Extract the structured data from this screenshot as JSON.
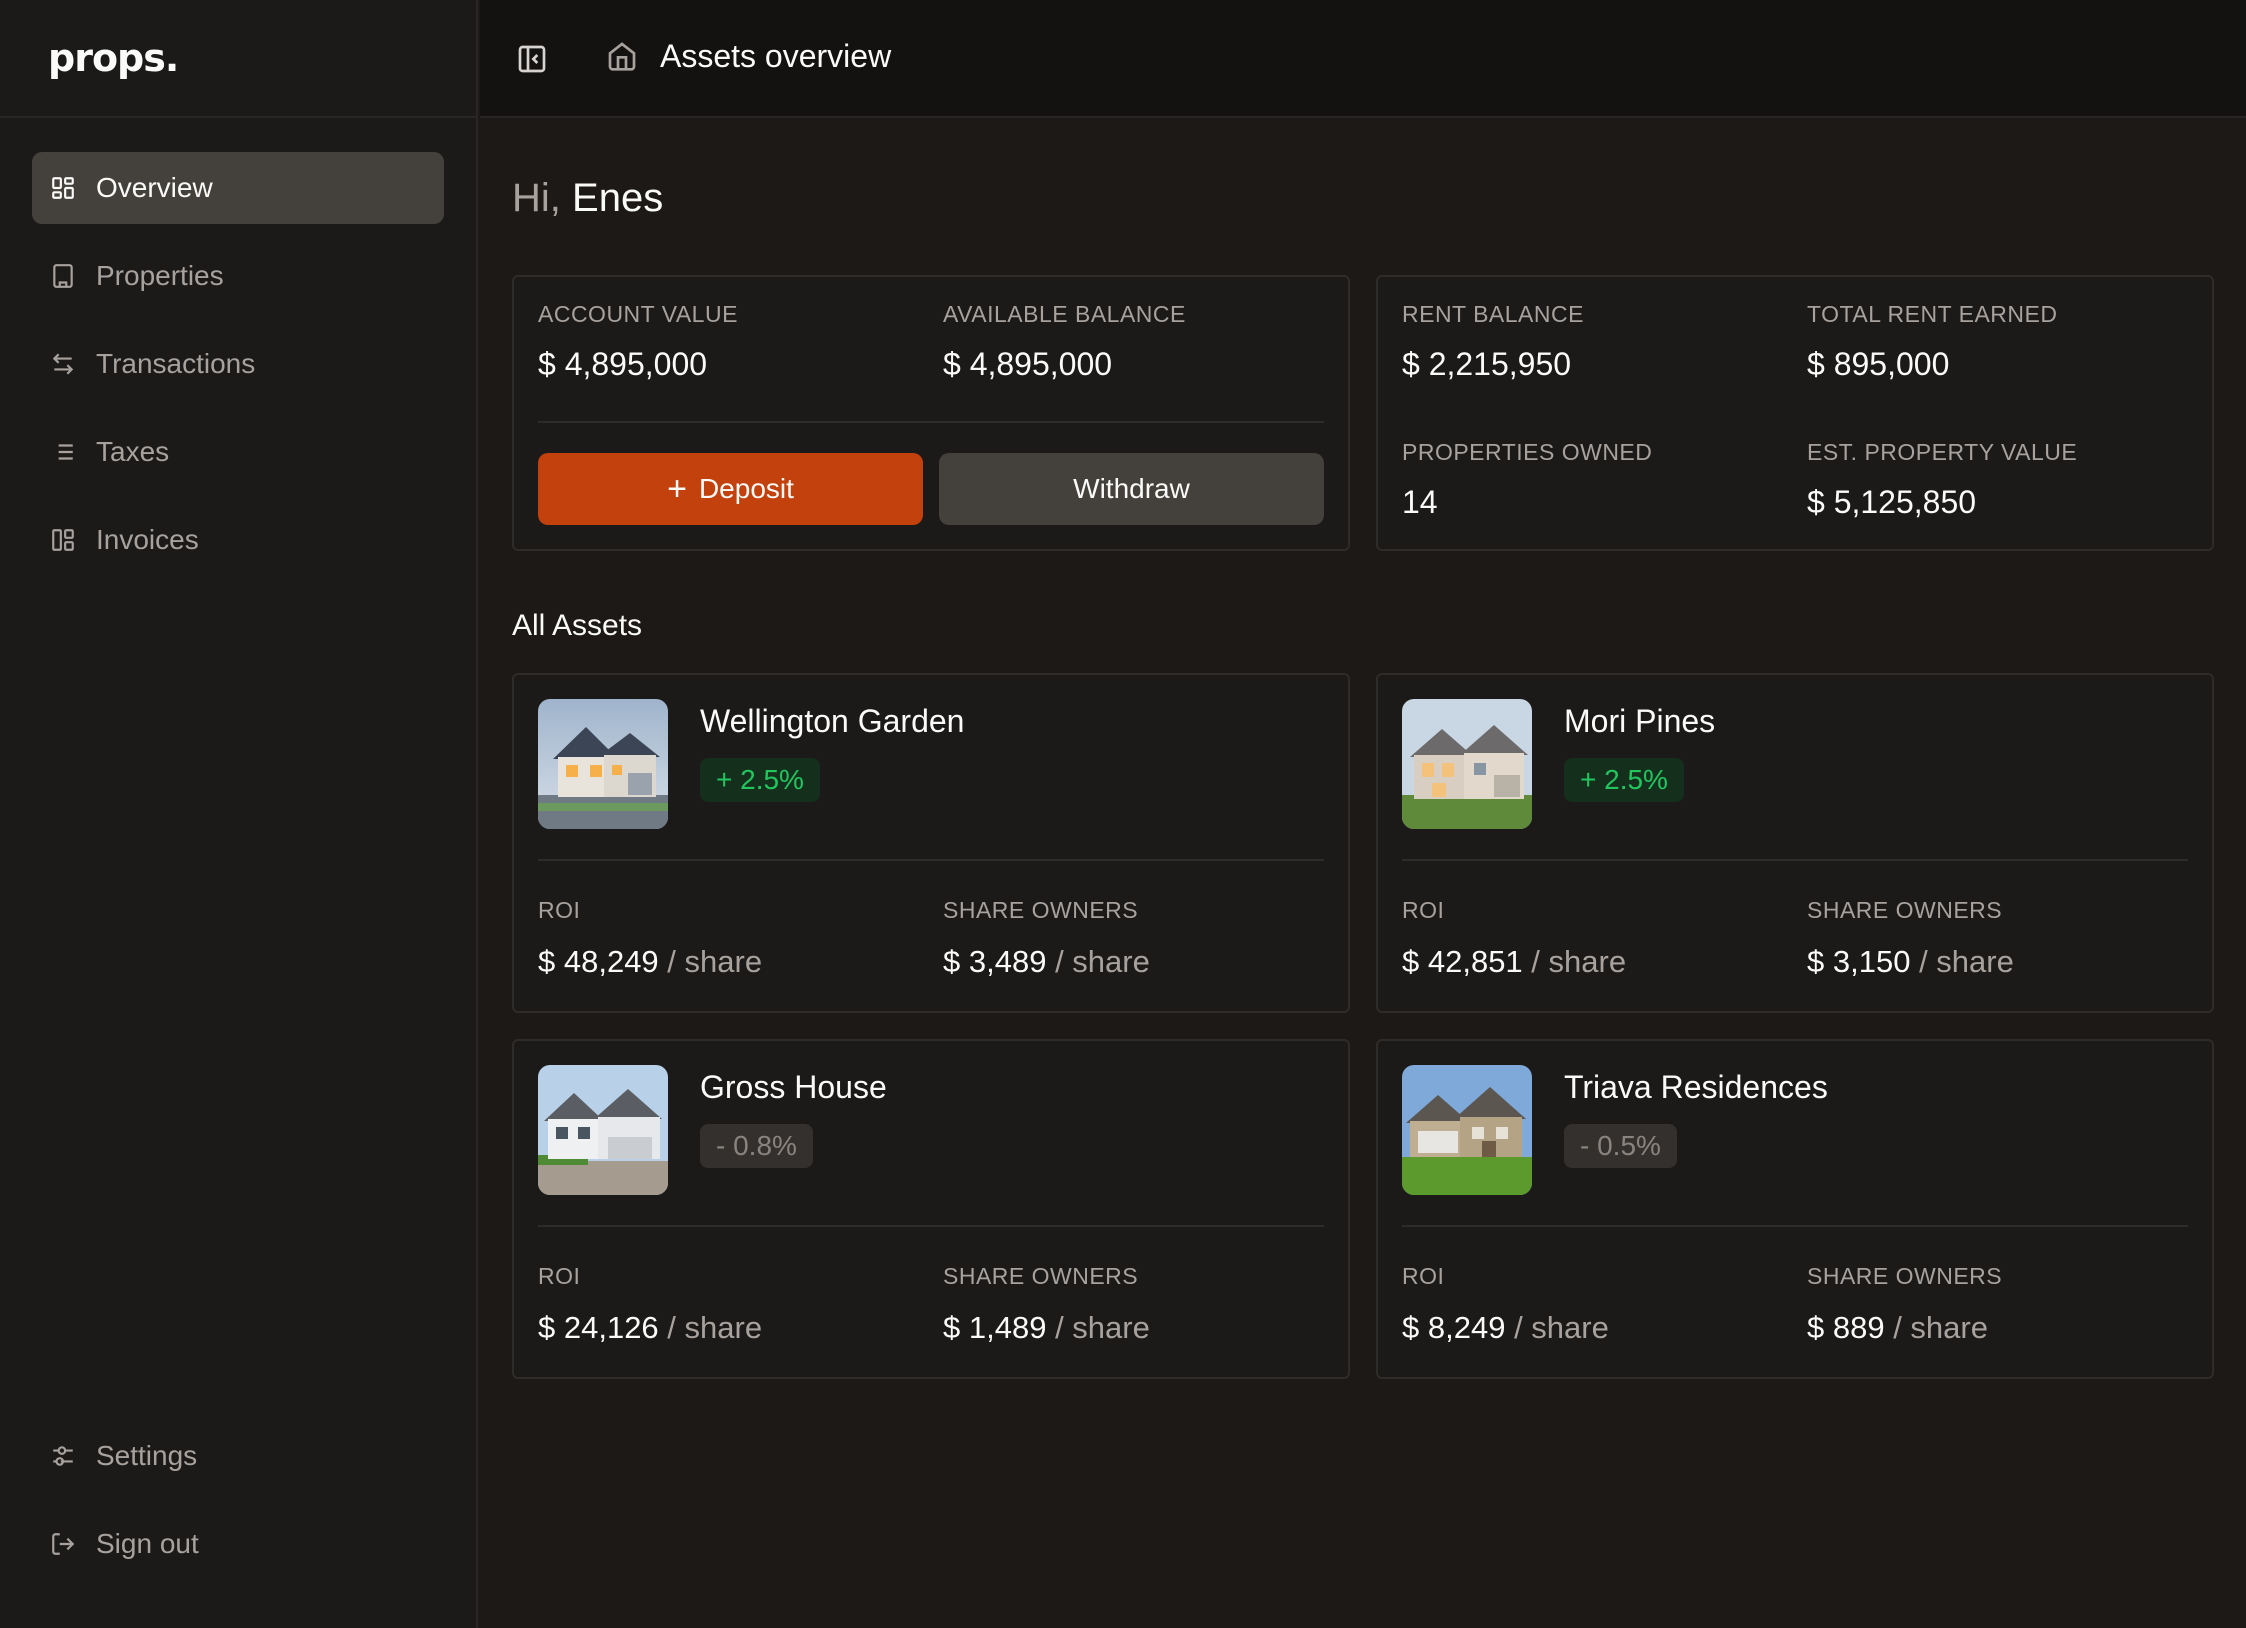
{
  "brand": {
    "name": "props."
  },
  "sidebar": {
    "items": [
      {
        "label": "Overview",
        "icon": "grid-icon",
        "active": true
      },
      {
        "label": "Properties",
        "icon": "building-icon",
        "active": false
      },
      {
        "label": "Transactions",
        "icon": "arrows-icon",
        "active": false
      },
      {
        "label": "Taxes",
        "icon": "list-icon",
        "active": false
      },
      {
        "label": "Invoices",
        "icon": "invoice-icon",
        "active": false
      }
    ],
    "bottom": [
      {
        "label": "Settings",
        "icon": "sliders-icon"
      },
      {
        "label": "Sign out",
        "icon": "sign-out-icon"
      }
    ]
  },
  "header": {
    "title": "Assets overview"
  },
  "greeting": {
    "hi": "Hi,",
    "name": "Enes"
  },
  "summary": {
    "account_value_label": "ACCOUNT VALUE",
    "account_value": "$ 4,895,000",
    "available_balance_label": "AVAILABLE BALANCE",
    "available_balance": "$ 4,895,000",
    "deposit_label": "Deposit",
    "withdraw_label": "Withdraw",
    "rent_balance_label": "RENT BALANCE",
    "rent_balance": "$ 2,215,950",
    "total_rent_label": "TOTAL RENT EARNED",
    "total_rent": "$ 895,000",
    "properties_owned_label": "PROPERTIES OWNED",
    "properties_owned": "14",
    "est_value_label": "EST. PROPERTY VALUE",
    "est_value": "$ 5,125,850"
  },
  "assets_title": "All Assets",
  "assets": [
    {
      "name": "Wellington Garden",
      "change": "+ 2.5%",
      "trend": "up",
      "roi_label": "ROI",
      "roi": "$ 48,249",
      "owners_label": "SHARE OWNERS",
      "owners": "$ 3,489",
      "unit": "/ share"
    },
    {
      "name": "Mori Pines",
      "change": "+ 2.5%",
      "trend": "up",
      "roi_label": "ROI",
      "roi": "$ 42,851",
      "owners_label": "SHARE OWNERS",
      "owners": "$ 3,150",
      "unit": "/ share"
    },
    {
      "name": "Gross House",
      "change": "- 0.8%",
      "trend": "down",
      "roi_label": "ROI",
      "roi": "$ 24,126",
      "owners_label": "SHARE OWNERS",
      "owners": "$ 1,489",
      "unit": "/ share"
    },
    {
      "name": "Triava Residences",
      "change": "- 0.5%",
      "trend": "down",
      "roi_label": "ROI",
      "roi": "$ 8,249",
      "owners_label": "SHARE OWNERS",
      "owners": "$ 889",
      "unit": "/ share"
    }
  ],
  "colors": {
    "accent": "#c2410c",
    "positive": "#22c55e",
    "background": "#1c1917"
  }
}
